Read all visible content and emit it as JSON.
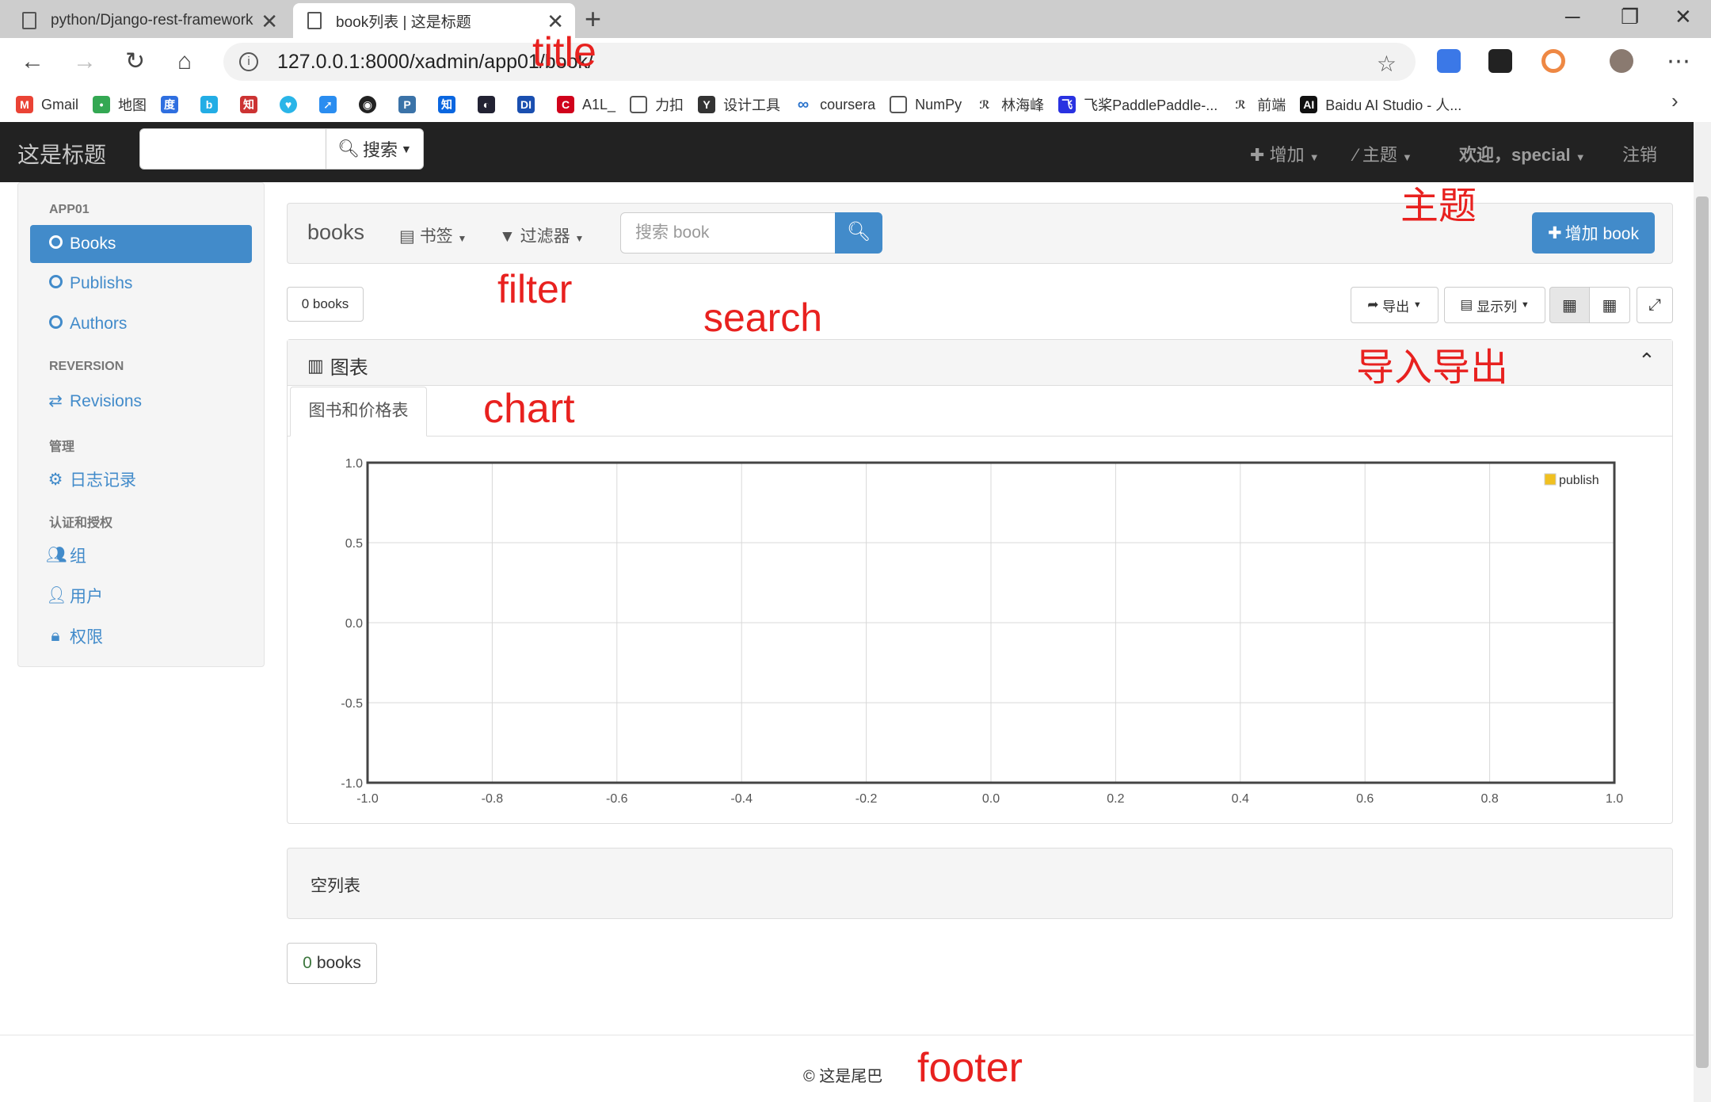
{
  "browser": {
    "tabs": [
      {
        "title": "python/Django-rest-framework",
        "active": false
      },
      {
        "title": "book列表 | 这是标题",
        "active": true
      }
    ],
    "url": "127.0.0.1:8000/xadmin/app01/book/",
    "bookmarks": [
      "Gmail",
      "地图",
      "A1L_",
      "力扣",
      "设计工具",
      "coursera",
      "NumPy",
      "林海峰",
      "飞桨PaddlePaddle-...",
      "前端",
      "Baidu AI Studio - 人..."
    ]
  },
  "navbar": {
    "brand": "这是标题",
    "search_button": "搜索",
    "add": "增加",
    "theme": "主题",
    "welcome": "欢迎，special",
    "logout": "注销"
  },
  "sidebar": {
    "sections": [
      {
        "header": "APP01",
        "items": [
          "Books",
          "Publishs",
          "Authors"
        ]
      },
      {
        "header": "REVERSION",
        "items": [
          "Revisions"
        ]
      },
      {
        "header": "管理",
        "items": [
          "日志记录"
        ]
      },
      {
        "header": "认证和授权",
        "items": [
          "组",
          "用户",
          "权限"
        ]
      }
    ]
  },
  "main": {
    "title": "books",
    "bookmark_menu": "书签",
    "filter_menu": "过滤器",
    "search_placeholder": "搜索 book",
    "add_button": "增加 book",
    "count_label": "0 books",
    "export_button": "导出",
    "columns_button": "显示列",
    "chart_panel_title": "图表",
    "chart_tab": "图书和价格表",
    "empty_text": "空列表",
    "count_num": "0",
    "count_unit": "books"
  },
  "footer": {
    "text": "© 这是尾巴"
  },
  "annotations": {
    "title": "title",
    "theme": "主题",
    "filter": "filter",
    "search": "search",
    "import_export": "导入导出",
    "chart": "chart",
    "footer": "footer"
  },
  "colors": {
    "primary": "#428bca",
    "navbar": "#222222",
    "annotation": "#e8211f",
    "legend": "#f0c020"
  },
  "chart_data": {
    "type": "line",
    "series": [
      {
        "name": "publish",
        "values": []
      }
    ],
    "xlim": [
      -1.0,
      1.0
    ],
    "ylim": [
      -1.0,
      1.0
    ],
    "xticks": [
      "-1.0",
      "-0.8",
      "-0.6",
      "-0.4",
      "-0.2",
      "0.0",
      "0.2",
      "0.4",
      "0.6",
      "0.8",
      "1.0"
    ],
    "yticks": [
      "1.0",
      "0.5",
      "0.0",
      "-0.5",
      "-1.0"
    ],
    "grid": true,
    "legend": "top-right"
  }
}
